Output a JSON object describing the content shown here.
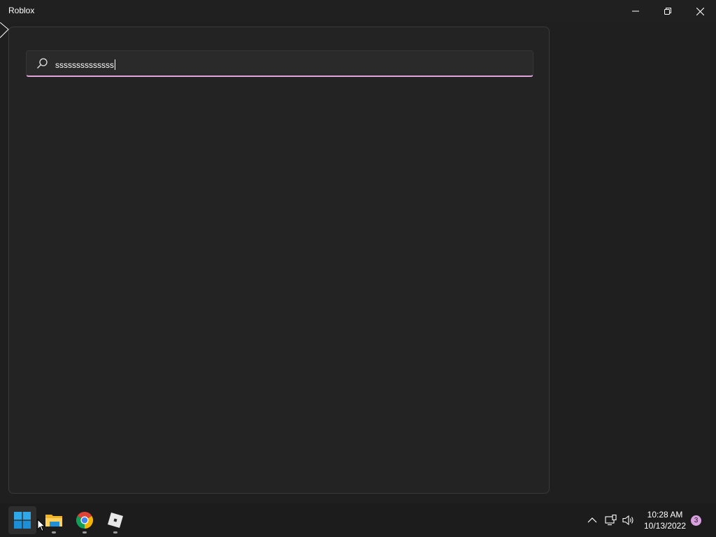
{
  "window": {
    "title": "Roblox",
    "controls": {
      "minimize_icon": "minimize-icon",
      "maximize_icon": "restore-icon",
      "close_icon": "close-icon"
    }
  },
  "search": {
    "value": "ssssssssssssss",
    "icon": "search-icon",
    "accent_color": "#e0a6dc"
  },
  "taskbar": {
    "apps": [
      {
        "name": "Start",
        "icon": "windows-start-icon"
      },
      {
        "name": "File Explorer",
        "icon": "folder-icon"
      },
      {
        "name": "Google Chrome",
        "icon": "chrome-icon"
      },
      {
        "name": "Roblox",
        "icon": "roblox-icon"
      }
    ],
    "tray": {
      "icons": [
        "chevron-up-icon",
        "network-icon",
        "volume-icon"
      ],
      "time": "10:28 AM",
      "date": "10/13/2022",
      "notification_count": "3"
    }
  }
}
